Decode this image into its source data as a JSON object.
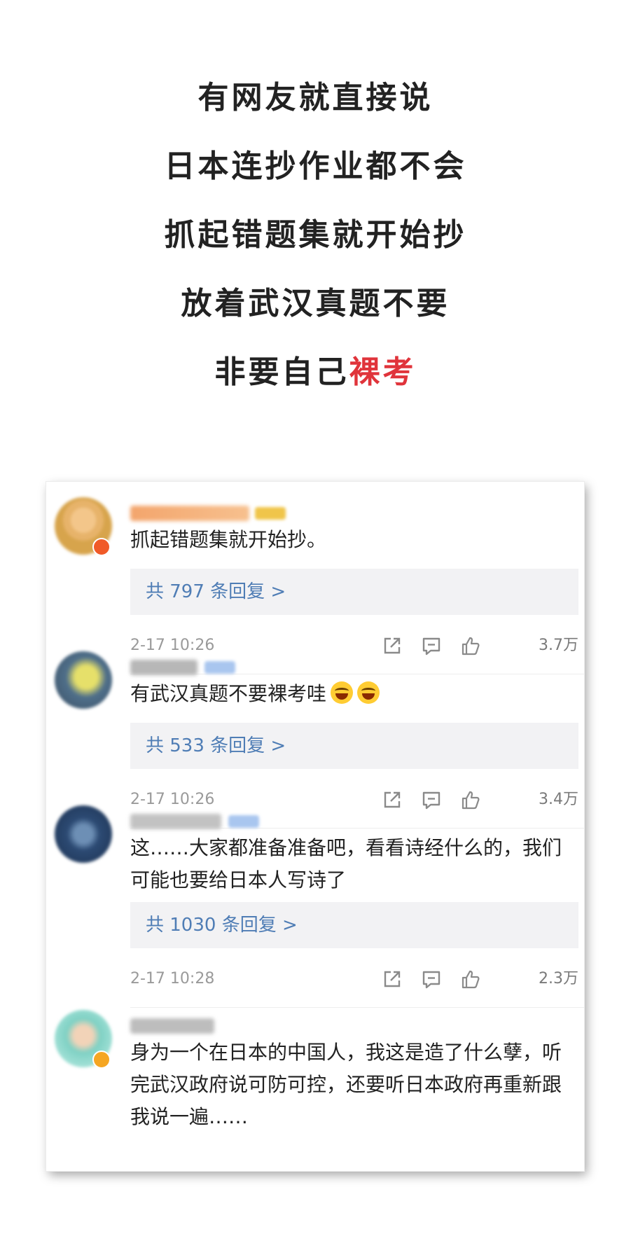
{
  "headlines": {
    "line1": "有网友就直接说",
    "line2": "日本连抄作业都不会",
    "line3": "抓起错题集就开始抄",
    "line4": "放着武汉真题不要",
    "line5_plain": "非要自己",
    "line5_accent": "裸考"
  },
  "colors": {
    "accent": "#e0343b",
    "reply_link": "#4f7db5",
    "reply_box_bg": "#f2f2f4"
  },
  "comments": [
    {
      "text": "抓起错题集就开始抄。",
      "reply_label": "共 797 条回复 >",
      "time": "2-17 10:26",
      "likes": "3.7万"
    },
    {
      "text": "有武汉真题不要裸考哇",
      "emoji": [
        "laughing-crying-emoji",
        "laughing-crying-emoji"
      ],
      "reply_label": "共 533 条回复 >",
      "time": "2-17 10:26",
      "likes": "3.4万"
    },
    {
      "text": "这……大家都准备准备吧，看看诗经什么的，我们可能也要给日本人写诗了",
      "reply_label": "共 1030 条回复 >",
      "time": "2-17 10:28",
      "likes": "2.3万"
    },
    {
      "text": "身为一个在日本的中国人，我这是造了什么孽，听完武汉政府说可防可控，还要听日本政府再重新跟我说一遍……"
    }
  ],
  "icons": {
    "share": "share-icon",
    "comment": "comment-icon",
    "like": "thumbs-up-icon"
  }
}
